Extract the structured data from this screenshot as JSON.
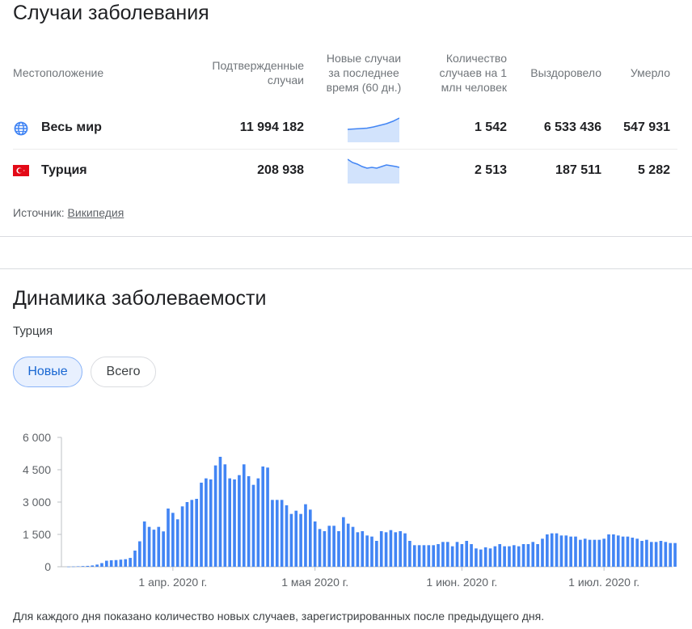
{
  "summary": {
    "title": "Случаи заболевания",
    "headers": {
      "location": "Местоположение",
      "confirmed": [
        "Подтвержденные",
        "случаи"
      ],
      "new_cases": [
        "Новые случаи",
        "за последнее",
        "время (60 дн.)"
      ],
      "per_million": [
        "Количество",
        "случаев на 1",
        "млн человек"
      ],
      "recovered": "Выздоровело",
      "deaths": "Умерло"
    },
    "rows": [
      {
        "name": "Весь мир",
        "icon": "globe-icon",
        "confirmed": "11 994 182",
        "per_million": "1 542",
        "recovered": "6 533 436",
        "deaths": "547 931"
      },
      {
        "name": "Турция",
        "icon": "turkey-flag-icon",
        "confirmed": "208 938",
        "per_million": "2 513",
        "recovered": "187 511",
        "deaths": "5 282"
      }
    ],
    "source_label": "Источник:",
    "source_link": "Википедия"
  },
  "dynamics": {
    "title": "Динамика заболеваемости",
    "region": "Турция",
    "chips": {
      "new": "Новые",
      "total": "Всего"
    },
    "note": "Для каждого дня показано количество новых случаев, зарегистрированных после предыдущего дня."
  },
  "colors": {
    "bar": "#4285f4",
    "spark_fill": "#d2e3fc",
    "spark_line": "#4285f4",
    "accent": "#1967d2"
  },
  "chart_data": {
    "type": "bar",
    "ylim": [
      0,
      6000
    ],
    "yticks": [
      0,
      1500,
      3000,
      4500,
      6000
    ],
    "ytick_labels": [
      "0",
      "1 500",
      "3 000",
      "4 500",
      "6 000"
    ],
    "xtick_labels": [
      {
        "label": "1 апр. 2020 г.",
        "index": 22
      },
      {
        "label": "1 мая 2020 г.",
        "index": 52
      },
      {
        "label": "1 июн. 2020 г.",
        "index": 83
      },
      {
        "label": "1 июл. 2020 г.",
        "index": 113
      }
    ],
    "values": [
      5,
      10,
      20,
      30,
      40,
      60,
      100,
      170,
      280,
      300,
      310,
      330,
      350,
      410,
      750,
      1180,
      2100,
      1850,
      1720,
      1850,
      1640,
      2700,
      2500,
      2200,
      2800,
      3000,
      3100,
      3150,
      3900,
      4100,
      4050,
      4700,
      5100,
      4750,
      4100,
      4050,
      4250,
      4750,
      4200,
      3800,
      4100,
      4650,
      4600,
      3100,
      3100,
      3100,
      2850,
      2450,
      2600,
      2450,
      2900,
      2650,
      2100,
      1750,
      1650,
      1900,
      1900,
      1650,
      2300,
      2000,
      1850,
      1600,
      1650,
      1450,
      1400,
      1200,
      1650,
      1600,
      1700,
      1600,
      1650,
      1550,
      1200,
      1000,
      1000,
      1000,
      1000,
      1000,
      1050,
      1150,
      1150,
      950,
      1150,
      1050,
      1200,
      1050,
      850,
      800,
      900,
      850,
      950,
      1050,
      950,
      950,
      1000,
      950,
      1050,
      1050,
      1150,
      1050,
      1300,
      1500,
      1550,
      1550,
      1450,
      1450,
      1400,
      1400,
      1250,
      1300,
      1250,
      1250,
      1250,
      1300,
      1500,
      1500,
      1450,
      1400,
      1400,
      1350,
      1300,
      1200,
      1250,
      1150,
      1150,
      1200,
      1150,
      1100,
      1100
    ]
  }
}
